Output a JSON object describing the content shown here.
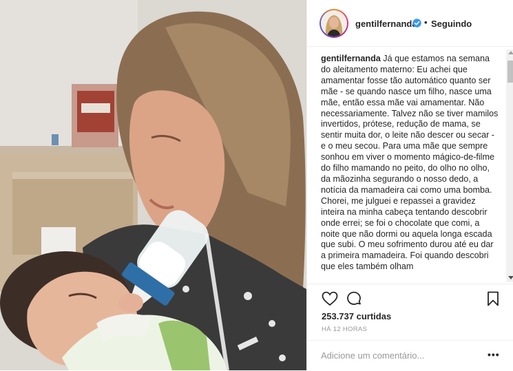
{
  "post": {
    "username": "gentilfernanda",
    "follow_status": "Seguindo",
    "separator": "•",
    "caption_username": "gentilfernanda",
    "caption_text": "Já que estamos na semana do aleitamento materno: Eu achei que amamentar fosse tão automático quanto ser mãe - se quando nasce um filho, nasce uma mãe, então essa mãe vai amamentar. Não necessariamente. Talvez não se tiver mamilos invertidos, prótese, redução de mama, se sentir muita dor, o leite não descer ou secar - e o meu secou. Para uma mãe que sempre sonhou em viver o momento mágico-de-filme do filho mamando no peito, do olho no olho, da mãozinha segurando o nosso dedo, a notícia da mamadeira cai como uma bomba. Chorei, me julguei e repassei a gravidez inteira na minha cabeça tentando descobrir onde errei; se foi o chocolate que comi, a noite que não dormi ou aquela longa escada que subi. O meu sofrimento durou até eu dar a primeira mamadeira. Foi quando descobri que eles também olham",
    "likes": "253.737 curtidas",
    "time": "HÁ 12 HORAS",
    "comment_placeholder": "Adicione um comentário...",
    "more_label": "•••"
  },
  "colors": {
    "text": "#262626",
    "muted": "#999999",
    "verified": "#3897f0",
    "border": "#efefef"
  },
  "icons": [
    "heart-icon",
    "comment-icon",
    "bookmark-icon",
    "verified-badge-icon",
    "more-options-icon"
  ]
}
